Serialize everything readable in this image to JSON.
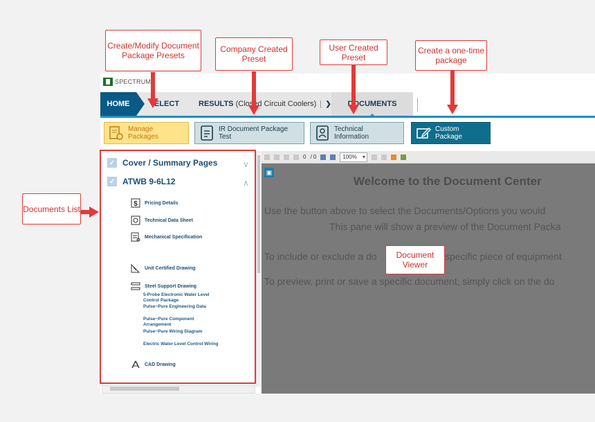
{
  "app": {
    "brand": "SPECTRUM",
    "nav": {
      "home": "HOME",
      "select": "ELECT",
      "results": "RESULTS",
      "results_paren": "(Closed Circuit Coolers)",
      "documents": "DOCUMENTS"
    },
    "toolbar": {
      "manage": "Manage Packages",
      "ir_preset": "IR Document Package Test",
      "tech_info": "Technical Information",
      "custom": "Custom Package"
    },
    "documents_list": {
      "section1": "Cover / Summary Pages",
      "section2": "ATWB 9-6L12",
      "items": [
        "Pricing Details",
        "Technical Data Sheet",
        "Mechanical Specification",
        "Unit Certified Drawing",
        "Steel Support Drawing"
      ],
      "subitems": [
        "5-Probe Electronic Water Level Control Package",
        "Pulse~Pure Engineering Data",
        "Pulse~Pure Component Arrangement",
        "Pulse~Pure Wiring Diagram",
        "Electric Water Level Control Wiring"
      ],
      "cad": "CAD Drawing"
    },
    "viewer": {
      "page_current": "0",
      "page_total": "/ 0",
      "zoom": "100%",
      "title": "Welcome to the Document Center",
      "line1": "Use the button above to select the Documents/Options you would",
      "line2": "This pane will show a preview of the Document Packa",
      "line3a": "To include or exclude a do",
      "line3b": "specific piece of equipment",
      "line4": "To preview, print or save a specific document, simply click on the do"
    }
  },
  "callouts": {
    "presets": "Create/Modify Document Package Presets",
    "company": "Company Created Preset",
    "user": "User Created Preset",
    "onetime": "Create a one-time package",
    "docs_list": "Documents List",
    "viewer": "Document Viewer"
  },
  "colors": {
    "annotation_red": "#e23a3a",
    "nav_blue": "#0a5a86",
    "accent_blue": "#1e8fc7",
    "manage_yellow": "#ffe38a",
    "custom_teal": "#0f6e8c"
  }
}
